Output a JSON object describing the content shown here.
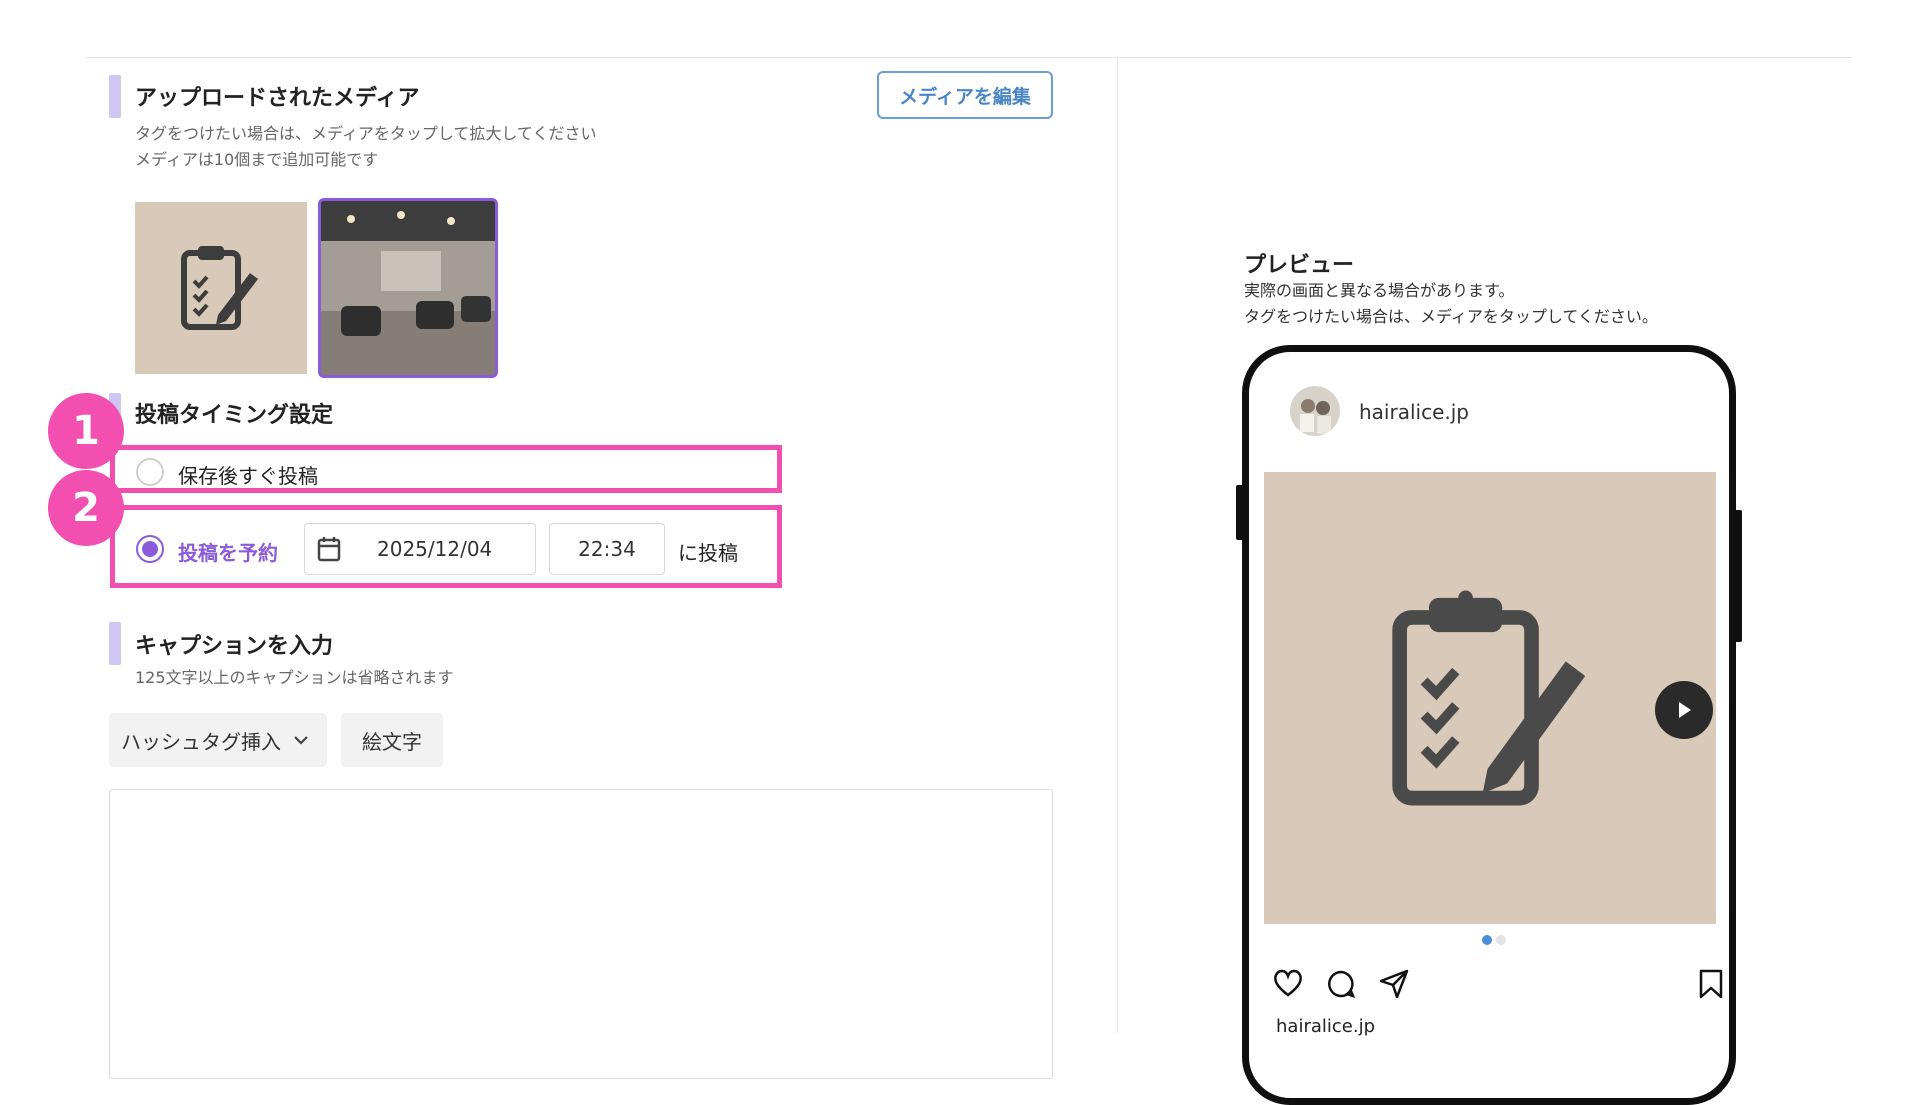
{
  "uploaded_media": {
    "title": "アップロードされたメディア",
    "hint_line1": "タグをつけたい場合は、メディアをタップして拡大してください",
    "hint_line2": "メディアは10個まで追加可能です",
    "edit_button": "メディアを編集"
  },
  "timing": {
    "title": "投稿タイミング設定",
    "immediate_label": "保存後すぐ投稿",
    "scheduled_label": "投稿を予約",
    "date_value": "2025/12/04",
    "time_value": "22:34",
    "suffix": "に投稿",
    "selected": "scheduled"
  },
  "annotations": {
    "badge1": "1",
    "badge2": "2"
  },
  "caption": {
    "title": "キャプションを入力",
    "hint": "125文字以上のキャプションは省略されます",
    "hashtag_button": "ハッシュタグ挿入",
    "emoji_button": "絵文字",
    "value": ""
  },
  "preview": {
    "title": "プレビュー",
    "note_line1": "実際の画面と異なる場合があります。",
    "note_line2": "タグをつけたい場合は、メディアをタップしてください。",
    "account_name": "hairalice.jp",
    "caption_account": "hairalice.jp"
  },
  "colors": {
    "accent_purple": "#8b5bdc",
    "annotation_pink": "#f24fb0",
    "link_blue": "#4a86c5",
    "media_beige": "#d9c9b9"
  },
  "icons": {
    "calendar": "calendar-icon",
    "chevron": "chevron-down-icon",
    "clipboard": "clipboard-edit-icon",
    "like": "heart-icon",
    "comment": "comment-icon",
    "share": "send-icon",
    "save": "bookmark-icon",
    "next": "play-next-icon"
  }
}
